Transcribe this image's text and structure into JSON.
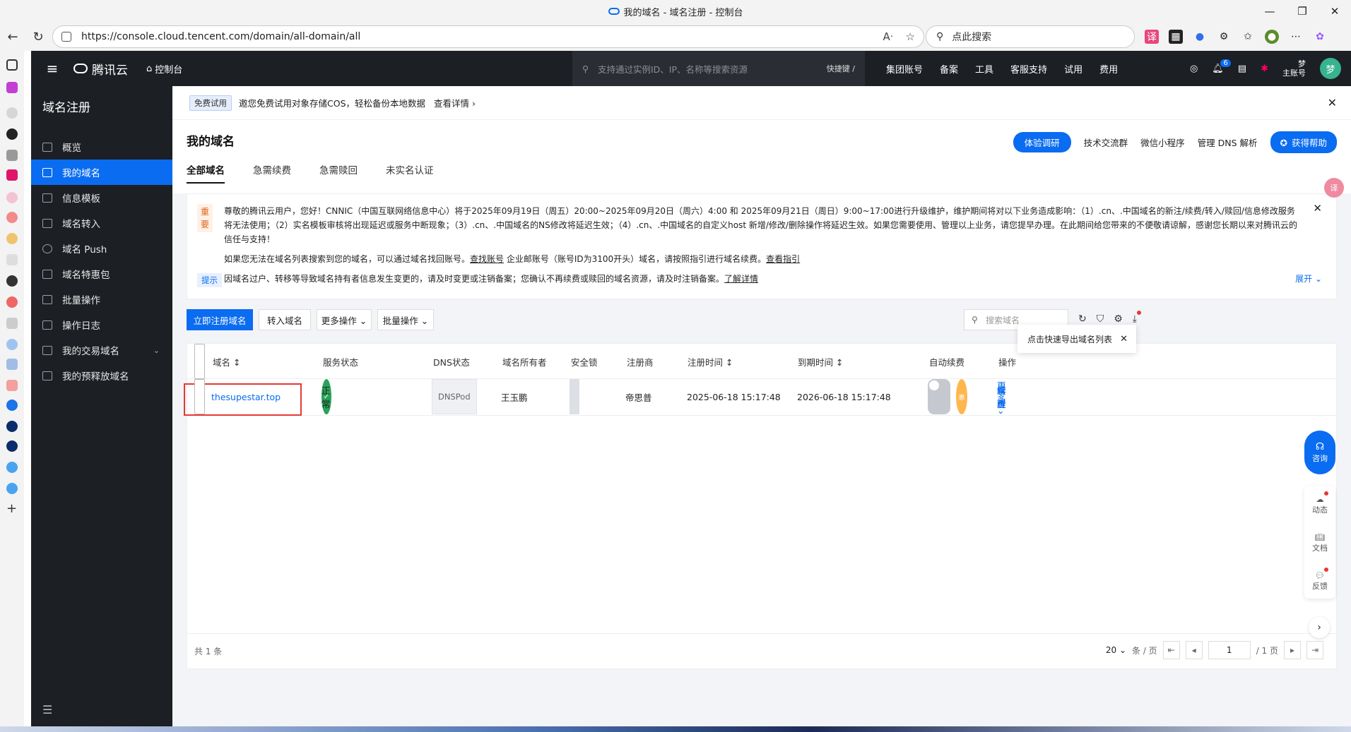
{
  "window": {
    "title": "我的域名 - 域名注册 - 控制台"
  },
  "browser": {
    "url": "https://console.cloud.tencent.com/domain/all-domain/all",
    "search_placeholder": "点此搜索"
  },
  "topnav": {
    "logo": "腾讯云",
    "console": "控制台",
    "search_placeholder": "支持通过实例ID、IP、名称等搜索资源",
    "shortcut": "快捷键 /",
    "links": [
      "集团账号",
      "备案",
      "工具",
      "客服支持",
      "试用",
      "费用"
    ],
    "notif_count": "6",
    "user_name": "梦",
    "user_role": "主账号",
    "avatar": "梦"
  },
  "sidebar": {
    "title": "域名注册",
    "items": [
      {
        "label": "概览"
      },
      {
        "label": "我的域名"
      },
      {
        "label": "信息模板"
      },
      {
        "label": "域名转入"
      },
      {
        "label": "域名 Push"
      },
      {
        "label": "域名特惠包"
      },
      {
        "label": "批量操作"
      },
      {
        "label": "操作日志"
      },
      {
        "label": "我的交易域名"
      },
      {
        "label": "我的预释放域名"
      }
    ],
    "active": "我的域名"
  },
  "banner": {
    "tag": "免费试用",
    "text": "邀您免费试用对象存储COS，轻松备份本地数据",
    "link": "查看详情 ›"
  },
  "page": {
    "title": "我的域名",
    "survey": "体验调研",
    "links": [
      "技术交流群",
      "微信小程序",
      "管理 DNS 解析"
    ],
    "help": "获得帮助",
    "tabs": [
      "全部域名",
      "急需续费",
      "急需赎回",
      "未实名认证"
    ]
  },
  "notice": {
    "important": "重要",
    "p1": "尊敬的腾讯云用户，您好！CNNIC（中国互联网络信息中心）将于2025年09月19日（周五）20:00~2025年09月20日（周六）4:00 和 2025年09月21日（周日）9:00~17:00进行升级维护，维护期间将对以下业务造成影响：（1）.cn、.中国域名的新注/续费/转入/赎回/信息修改服务将无法使用；（2）实名模板审核将出现延迟或服务中断现象；（3）.cn、.中国域名的NS修改将延迟生效；（4）.cn、.中国域名的自定义host 新增/修改/删除操作将延迟生效。如果您需要使用、管理以上业务，请您提早办理。在此期间给您带来的不便敬请谅解，感谢您长期以来对腾讯云的信任与支持！",
    "p2a": "如果您无法在域名列表搜索到您的域名，可以通过域名找回账号。",
    "p2b": "查找账号",
    "p2c": " 企业邮账号（账号ID为3100开头）域名，请按照指引进行域名续费。",
    "p2d": "查看指引",
    "tip": "提示",
    "p3a": "因域名过户、转移等导致域名持有者信息发生变更的，请及时变更或注销备案；您确认不再续费或赎回的域名资源，请及时注销备案。",
    "p3b": "了解详情",
    "expand": "展开 ⌄"
  },
  "toolbar": {
    "register": "立即注册域名",
    "transfer": "转入域名",
    "more": "更多操作 ⌄",
    "batch": "批量操作 ⌄",
    "search_placeholder": "搜索域名",
    "tooltip": "点击快速导出域名列表"
  },
  "table": {
    "headers": [
      "域名 ↕",
      "服务状态",
      "DNS状态",
      "域名所有者",
      "安全锁",
      "注册商",
      "注册时间 ↕",
      "到期时间 ↕",
      "自动续费",
      "操作"
    ],
    "rows": [
      {
        "domain": "thesupestar.top",
        "status": "正常",
        "dns": "DNSPod",
        "owner": "王玉鹏",
        "registrar": "帝思普",
        "reg_time": "2025-06-18 15:17:48",
        "exp_time": "2026-06-18 15:17:48",
        "ops": [
          "续费",
          "解析",
          "管理",
          "更多 ⌄"
        ]
      }
    ],
    "total": "共 1 条",
    "page_size": "20 ⌄",
    "per_page": "条 / 页",
    "page": "1",
    "page_total": "/ 1 页"
  },
  "float": {
    "consult": "咨询",
    "items": [
      "动态",
      "文档",
      "反馈"
    ],
    "hui": "惠",
    "trans": "译"
  }
}
